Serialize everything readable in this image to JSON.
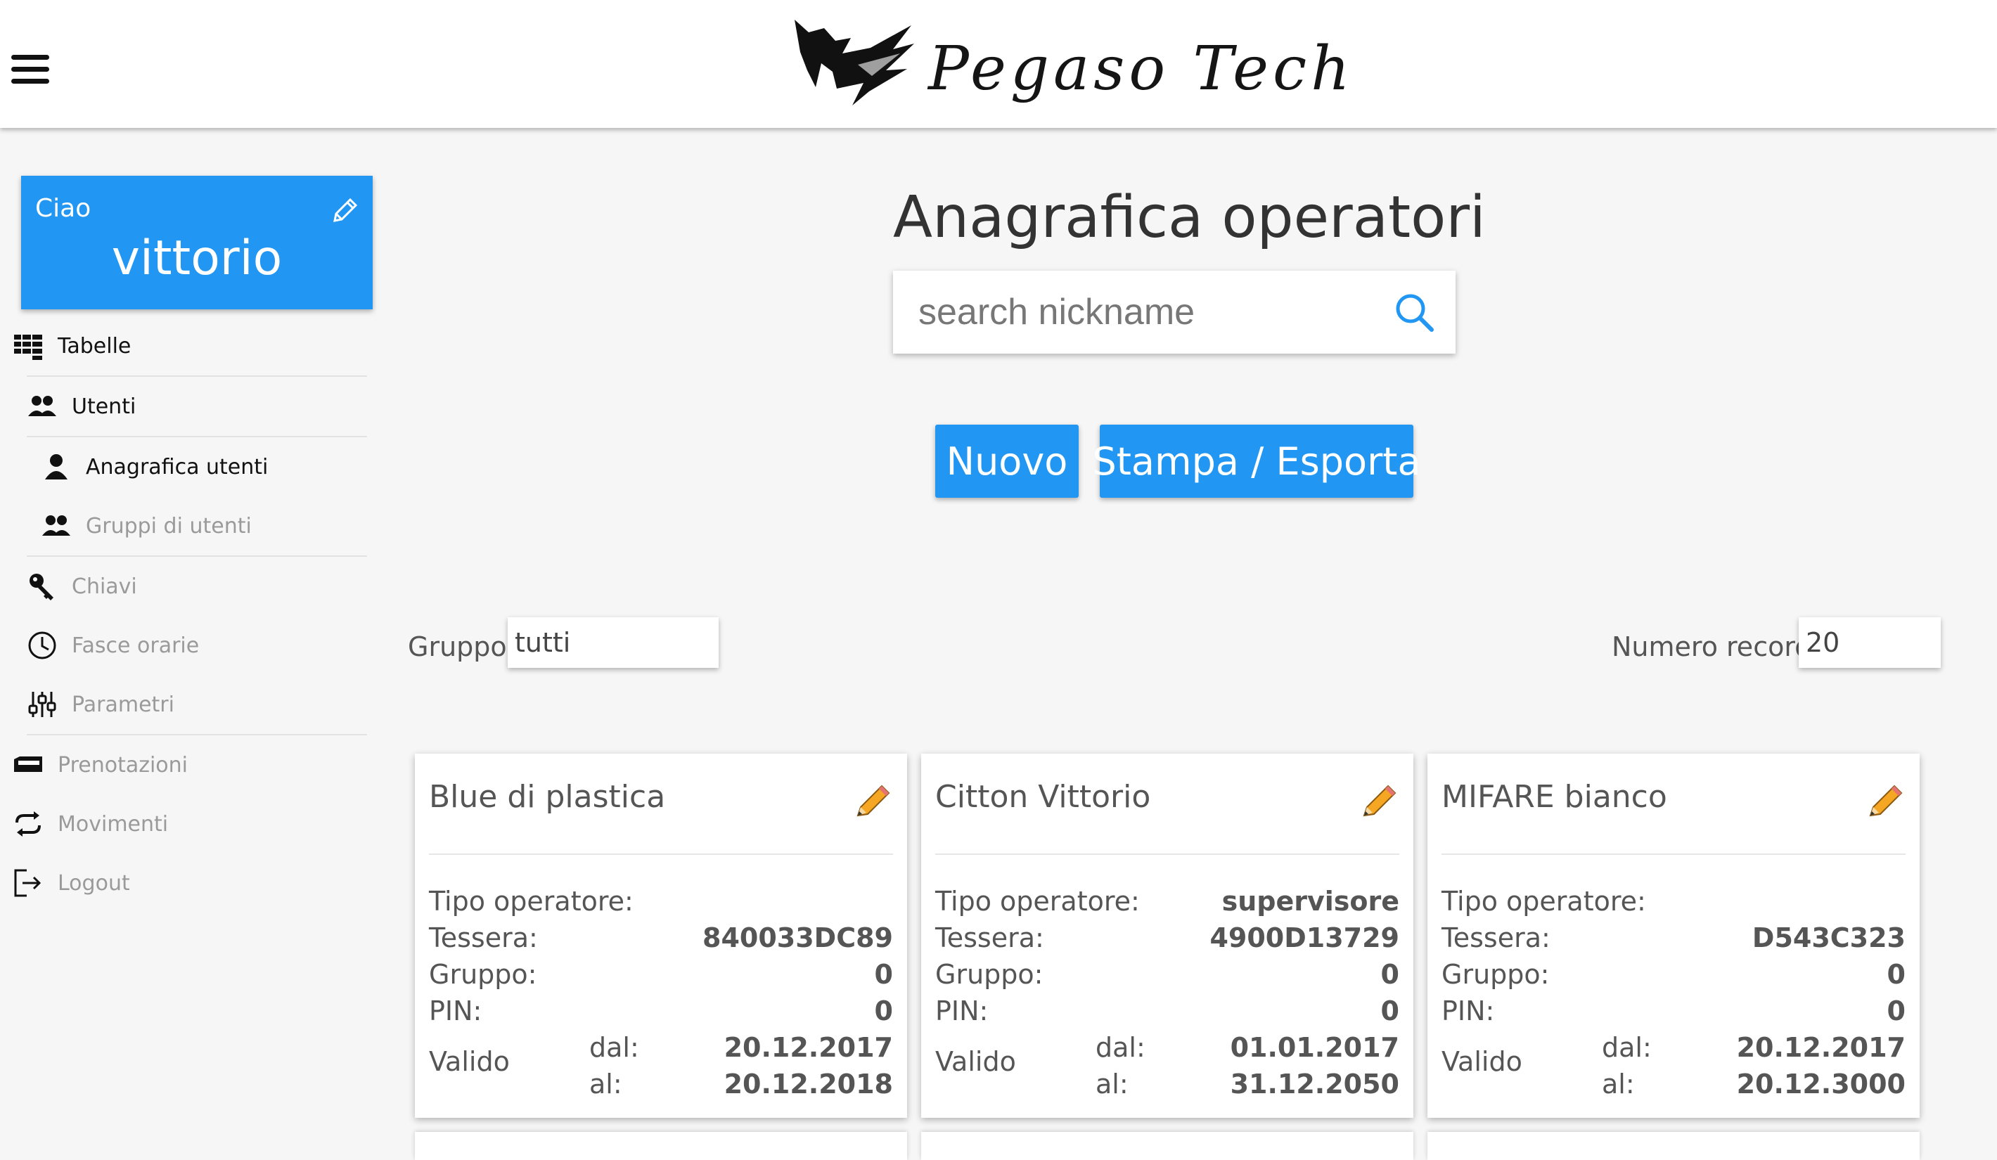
{
  "header": {
    "brand": "Pegaso Tech",
    "menu_icon": "hamburger-icon"
  },
  "sidebar": {
    "greeting": "Ciao",
    "username": "vittorio",
    "items": [
      {
        "label": "Tabelle",
        "icon": "table-icon"
      },
      {
        "label": "Utenti",
        "icon": "users-icon"
      },
      {
        "label": "Anagrafica utenti",
        "icon": "user-icon"
      },
      {
        "label": "Gruppi di utenti",
        "icon": "users-group-icon"
      },
      {
        "label": "Chiavi",
        "icon": "key-icon"
      },
      {
        "label": "Fasce orarie",
        "icon": "clock-icon"
      },
      {
        "label": "Parametri",
        "icon": "sliders-icon"
      },
      {
        "label": "Prenotazioni",
        "icon": "card-icon"
      },
      {
        "label": "Movimenti",
        "icon": "repeat-icon"
      },
      {
        "label": "Logout",
        "icon": "logout-icon"
      }
    ]
  },
  "main": {
    "title": "Anagrafica operatori",
    "search_placeholder": "search nickname",
    "new_button": "Nuovo",
    "export_button": "Stampa / Esporta",
    "group_label": "Gruppo:",
    "group_value": "tutti",
    "records_label": "Numero record:",
    "records_value": "20"
  },
  "card_labels": {
    "tipo": "Tipo operatore:",
    "tessera": "Tessera:",
    "gruppo": "Gruppo:",
    "pin": "PIN:",
    "valido": "Valido",
    "dal": "dal:",
    "al": "al:"
  },
  "cards": [
    {
      "name": "Blue di plastica",
      "tipo": "",
      "tessera": "840033DC89",
      "gruppo": "0",
      "pin": "0",
      "dal": "20.12.2017",
      "al": "20.12.2018"
    },
    {
      "name": "Citton Vittorio",
      "tipo": "supervisore",
      "tessera": "4900D13729",
      "gruppo": "0",
      "pin": "0",
      "dal": "01.01.2017",
      "al": "31.12.2050"
    },
    {
      "name": "MIFARE bianco",
      "tipo": "",
      "tessera": "D543C323",
      "gruppo": "0",
      "pin": "0",
      "dal": "20.12.2017",
      "al": "20.12.3000"
    }
  ],
  "colors": {
    "accent": "#2196f3",
    "background": "#f6f6f6",
    "text": "#333333",
    "muted": "#9a9a9a"
  }
}
